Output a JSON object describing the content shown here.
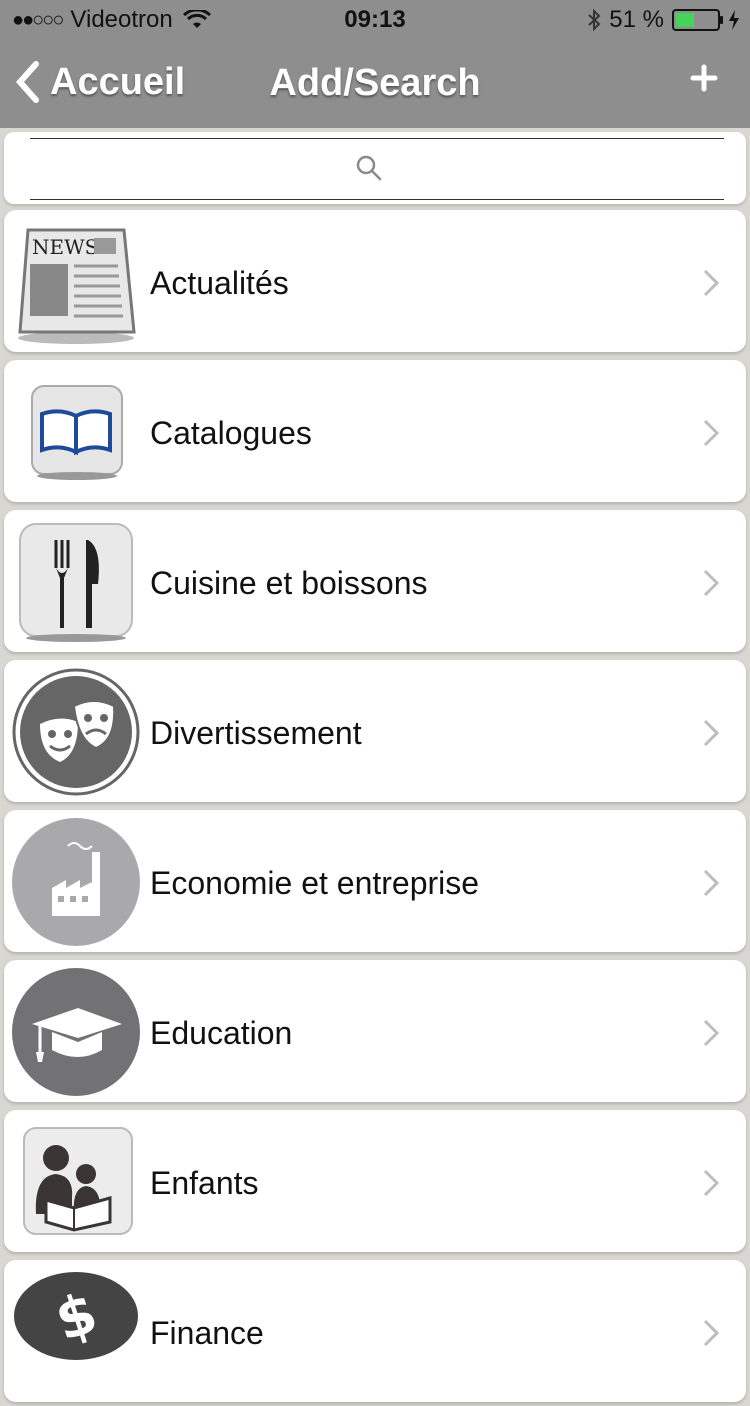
{
  "status_bar": {
    "signal_dots": "●●○○○",
    "carrier": "Videotron",
    "time": "09:13",
    "battery_percent": "51 %",
    "battery_level": 0.51
  },
  "nav": {
    "back_label": "Accueil",
    "title": "Add/Search",
    "add_icon": "plus-icon"
  },
  "search": {
    "placeholder": "",
    "icon": "search-icon"
  },
  "categories": [
    {
      "label": "Actualités",
      "icon": "newspaper-icon"
    },
    {
      "label": "Catalogues",
      "icon": "book-icon"
    },
    {
      "label": "Cuisine et boissons",
      "icon": "fork-knife-icon"
    },
    {
      "label": "Divertissement",
      "icon": "theater-masks-icon"
    },
    {
      "label": "Economie et entreprise",
      "icon": "factory-icon"
    },
    {
      "label": "Education",
      "icon": "graduation-cap-icon"
    },
    {
      "label": "Enfants",
      "icon": "reading-family-icon"
    },
    {
      "label": "Finance",
      "icon": "dollar-icon"
    }
  ],
  "colors": {
    "nav_bg": "#8e8e8e",
    "list_bg": "#d9d7d2",
    "battery_fill": "#46d35a",
    "chevron": "#bdbdbd"
  }
}
